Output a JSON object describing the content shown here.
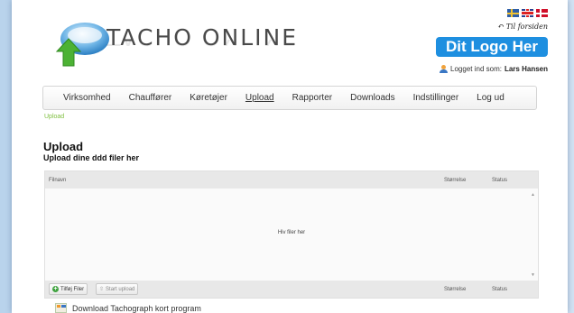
{
  "header": {
    "logo_text": "TACHO ONLINE",
    "flags": [
      "swedish-flag-icon",
      "uk-flag-icon",
      "danish-flag-icon"
    ],
    "to_front": "Til forsiden",
    "brand_placeholder": "Dit Logo Her",
    "logged_in_label": "Logget ind som:",
    "user_name": "Lars Hansen"
  },
  "nav": {
    "items": [
      {
        "label": "Virksomhed"
      },
      {
        "label": "Chauffører"
      },
      {
        "label": "Køretøjer"
      },
      {
        "label": "Upload",
        "active": true
      },
      {
        "label": "Rapporter"
      },
      {
        "label": "Downloads"
      },
      {
        "label": "Indstillinger"
      },
      {
        "label": "Log ud"
      }
    ]
  },
  "breadcrumb": "Upload",
  "page": {
    "title": "Upload",
    "subtitle": "Upload dine ddd filer her"
  },
  "upload": {
    "columns": {
      "filename": "Filnavn",
      "size": "Størrelse",
      "status": "Status"
    },
    "drop_text": "Hiv filer her",
    "add_files_label": "Tilføj Filer",
    "start_upload_label": "Start upload"
  },
  "download_link": "Download Tachograph kort program",
  "colors": {
    "accent": "#1e8fe0",
    "breadcrumb": "#7fbf3f",
    "background": "#c9dcf0"
  }
}
